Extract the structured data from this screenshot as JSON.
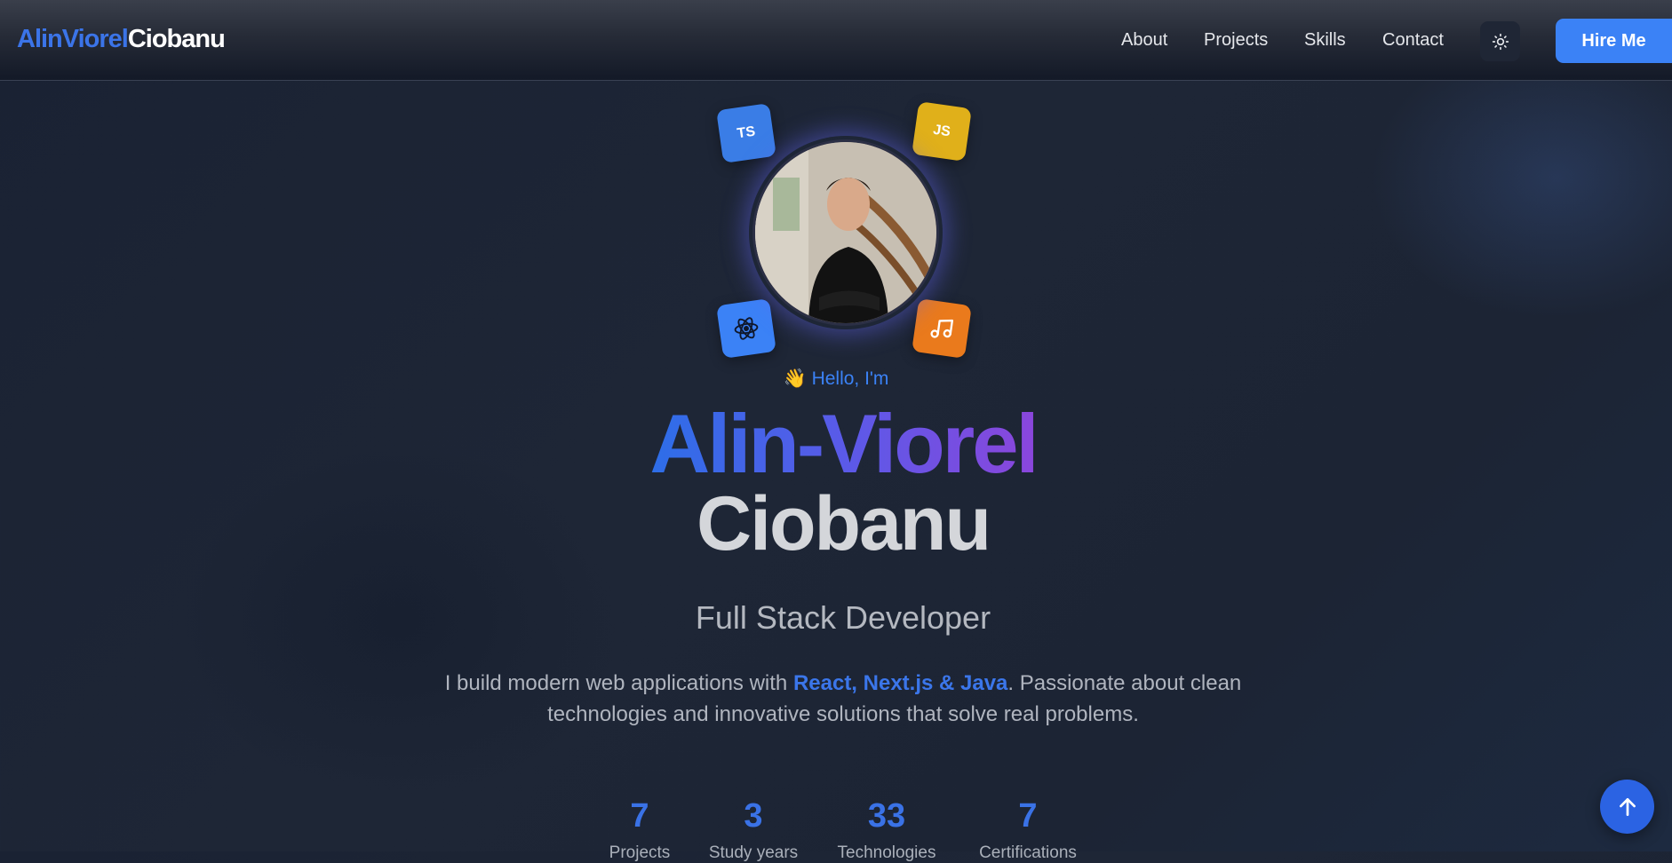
{
  "header": {
    "logo_first": "AlinViorel",
    "logo_last": "Ciobanu",
    "nav": [
      "About",
      "Projects",
      "Skills",
      "Contact"
    ],
    "theme_icon": "sun-icon",
    "hire_label": "Hire Me"
  },
  "hero": {
    "tech_badges": [
      {
        "label": "TS",
        "icon": "typescript-icon",
        "color": "#3a7de6"
      },
      {
        "label": "JS",
        "icon": "javascript-icon",
        "color": "#e0b01a"
      },
      {
        "label": "",
        "icon": "react-icon",
        "color": "#3b82f6"
      },
      {
        "label": "",
        "icon": "music-icon",
        "color": "#ea7a1c"
      }
    ],
    "hello": "Hello, I'm",
    "first_name": "Alin-Viorel",
    "last_name": "Ciobanu",
    "role": "Full Stack Developer",
    "desc_before": "I build modern web applications with ",
    "desc_highlight": "React, Next.js & Java",
    "desc_after": ". Passionate about clean technologies and innovative solutions that solve real problems."
  },
  "stats": [
    {
      "value": "7",
      "label": "Projects"
    },
    {
      "value": "3",
      "label": "Study years"
    },
    {
      "value": "33",
      "label": "Technologies"
    },
    {
      "value": "7",
      "label": "Certifications"
    }
  ],
  "colors": {
    "accent": "#3b82f6",
    "gradient_start": "#2d6ee8",
    "gradient_end": "#8b46dc"
  },
  "scroll_top_icon": "arrow-up-icon"
}
